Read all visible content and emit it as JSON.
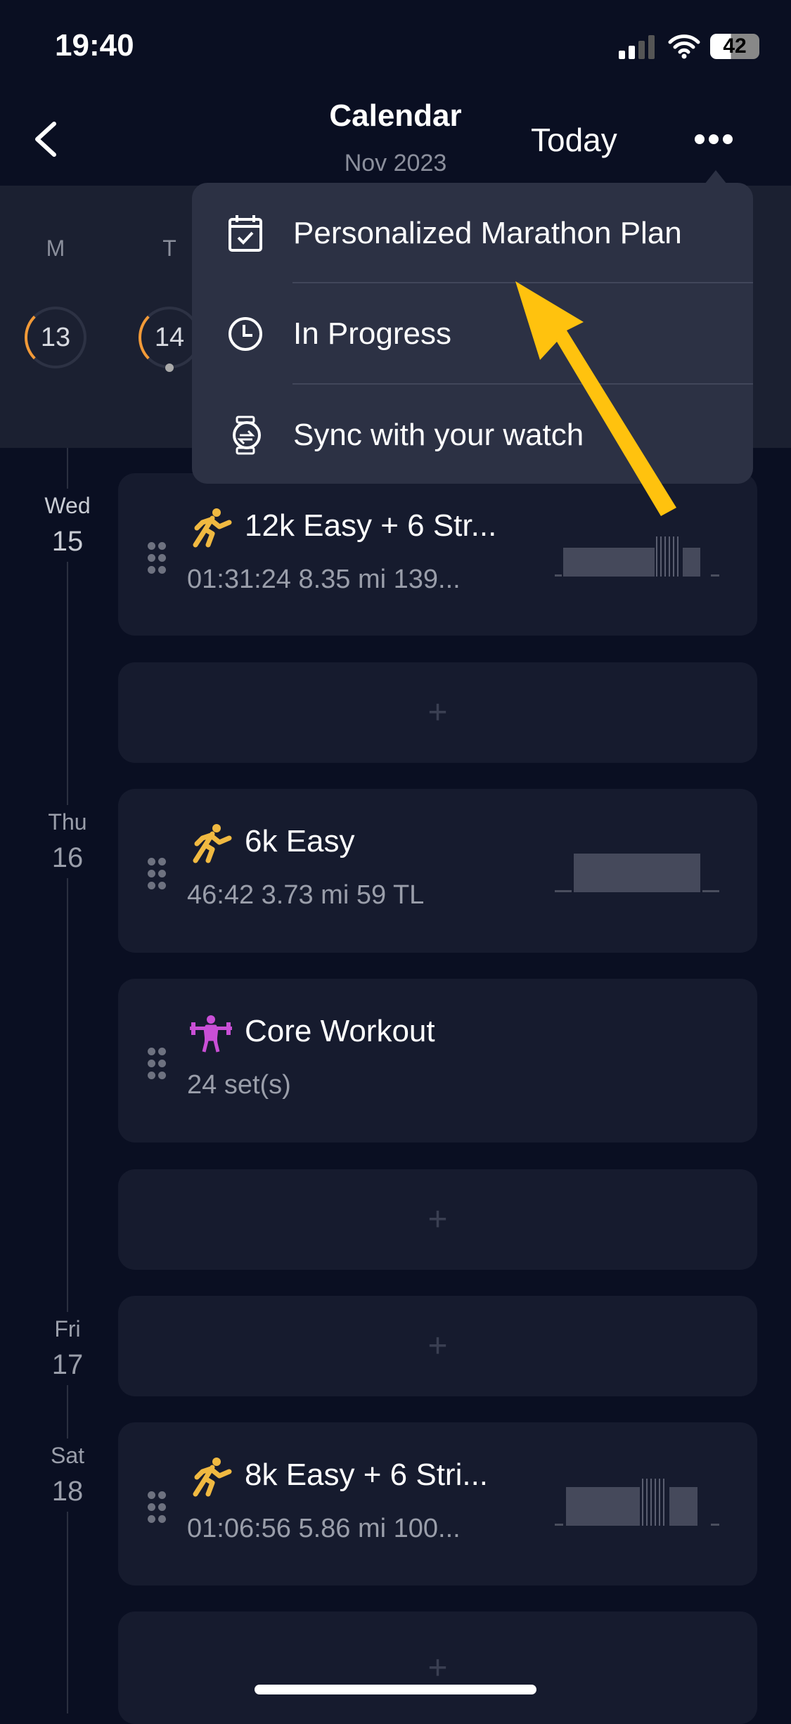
{
  "status": {
    "time": "19:40",
    "battery": "42"
  },
  "header": {
    "title": "Calendar",
    "subtitle": "Nov 2023",
    "today_label": "Today"
  },
  "week": [
    {
      "letter": "M",
      "date": "13"
    },
    {
      "letter": "T",
      "date": "14"
    }
  ],
  "menu": {
    "items": [
      {
        "label": "Personalized Marathon Plan",
        "icon": "calendar-check-icon"
      },
      {
        "label": "In Progress",
        "icon": "clock-icon"
      },
      {
        "label": "Sync with your watch",
        "icon": "watch-sync-icon"
      }
    ]
  },
  "days": [
    {
      "weekday": "Wed",
      "date": "15"
    },
    {
      "weekday": "Thu",
      "date": "16"
    },
    {
      "weekday": "Fri",
      "date": "17"
    },
    {
      "weekday": "Sat",
      "date": "18"
    }
  ],
  "workouts": [
    {
      "title": "12k Easy + 6 Str...",
      "stats": "01:31:24  8.35 mi  139...",
      "icon": "running-icon"
    },
    {
      "title": "6k Easy",
      "stats": "46:42  3.73 mi  59 TL",
      "icon": "running-icon"
    },
    {
      "title": "Core Workout",
      "stats": "24 set(s)",
      "icon": "weightlifting-icon"
    },
    {
      "title": "8k Easy + 6 Stri...",
      "stats": "01:06:56  5.86 mi  100...",
      "icon": "running-icon"
    }
  ],
  "add_label": "+",
  "colors": {
    "accent_run": "#f0b941",
    "accent_strength": "#c94fd6",
    "arrow": "#ffc20e",
    "ring_progress": "#f29a38"
  }
}
